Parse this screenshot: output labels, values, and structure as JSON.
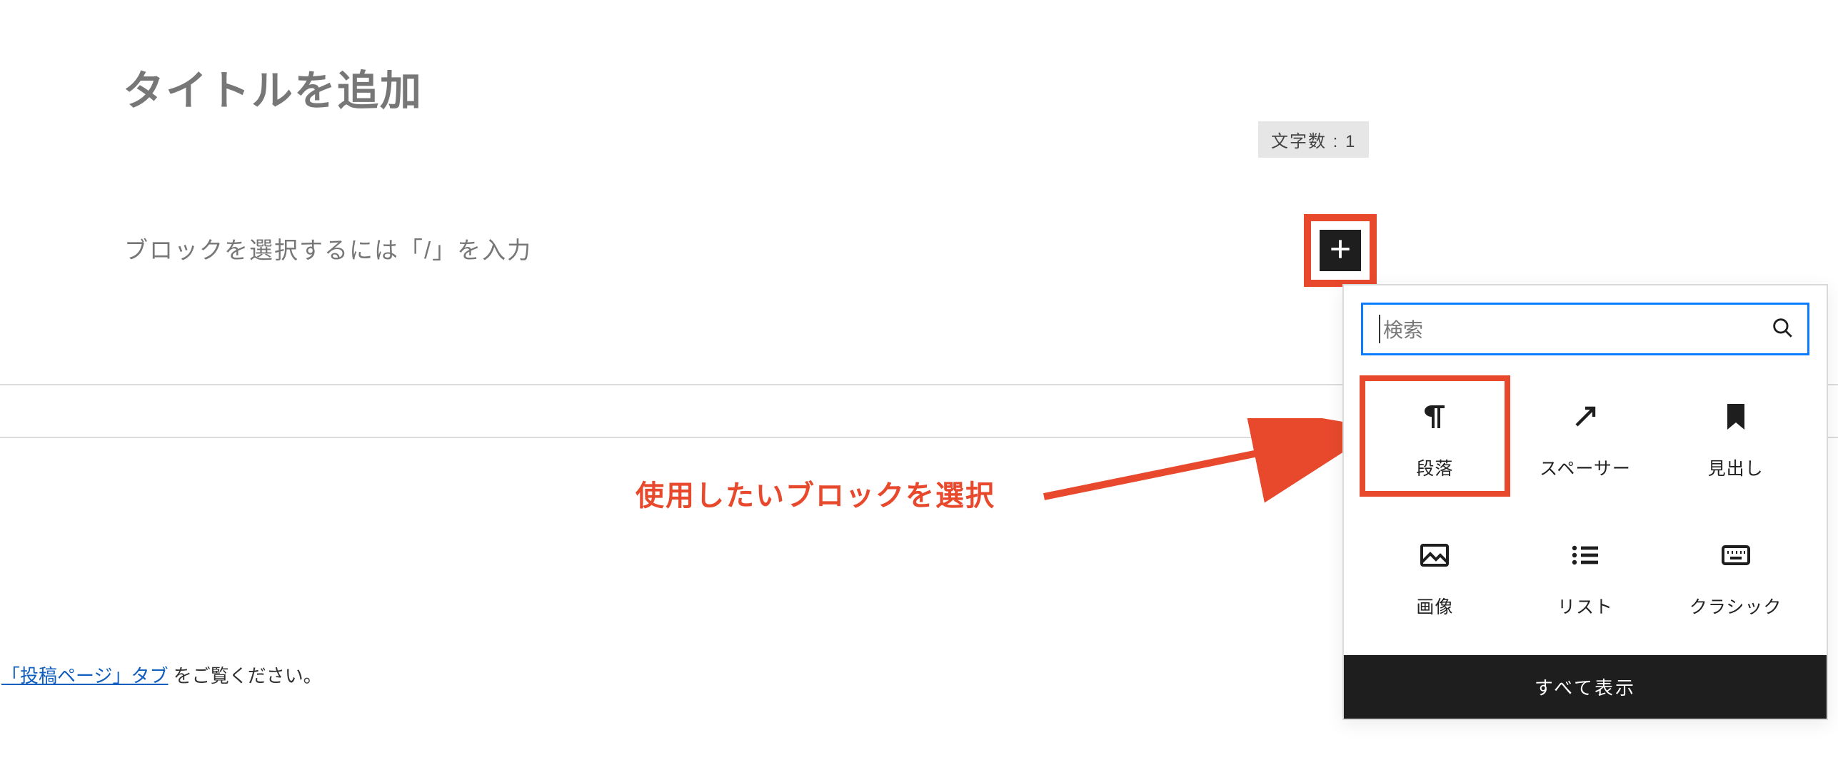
{
  "title_placeholder": "タイトルを追加",
  "char_count_label": "文字数 : 1",
  "block_placeholder": "ブロックを選択するには「/」を入力",
  "annotation_text": "使用したいブロックを選択",
  "footer": {
    "link_text": "「投稿ページ」タブ",
    "suffix": " をご覧ください。"
  },
  "inserter": {
    "search_placeholder": "検索",
    "blocks": [
      {
        "key": "paragraph",
        "label": "段落"
      },
      {
        "key": "spacer",
        "label": "スペーサー"
      },
      {
        "key": "heading",
        "label": "見出し"
      },
      {
        "key": "image",
        "label": "画像"
      },
      {
        "key": "list",
        "label": "リスト"
      },
      {
        "key": "classic",
        "label": "クラシック"
      }
    ],
    "show_all_label": "すべて表示"
  }
}
